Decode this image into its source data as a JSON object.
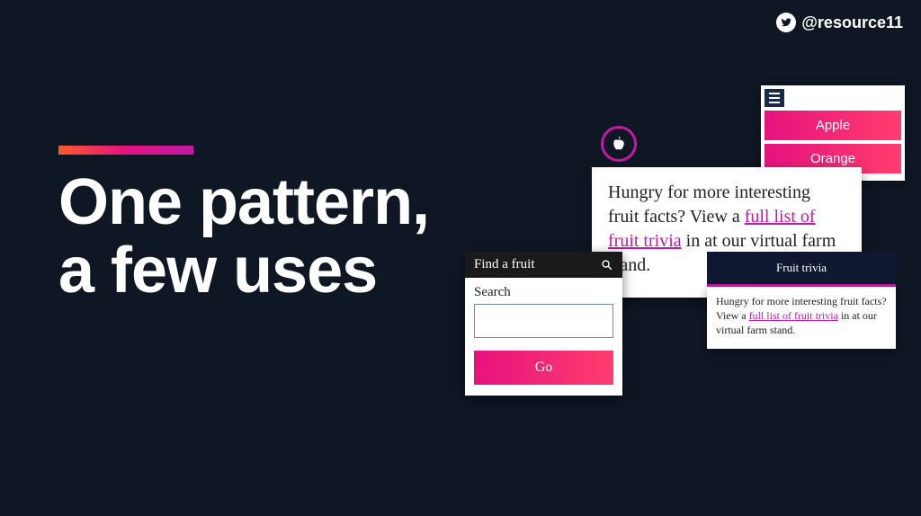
{
  "social": {
    "handle": "@resource11"
  },
  "accent_gradient": [
    "#ff5a2b",
    "#e6127f",
    "#c01aa5"
  ],
  "title_line1": "One pattern,",
  "title_line2": "a few uses",
  "menu": {
    "items": [
      "Apple",
      "Orange"
    ]
  },
  "trivia_card": {
    "text_before_link": "Hungry for more interesting fruit facts? View a ",
    "link_text": "full list of fruit trivia",
    "text_after_link": " in at our virtual farm stand."
  },
  "search": {
    "header": "Find a fruit",
    "label": "Search",
    "go_label": "Go"
  },
  "trivia_mini": {
    "bar_label": "Fruit trivia",
    "text_before_link": "Hungry for more interesting fruit facts? View a ",
    "link_text": "full list of fruit trivia",
    "text_after_link": " in at our virtual farm stand."
  }
}
